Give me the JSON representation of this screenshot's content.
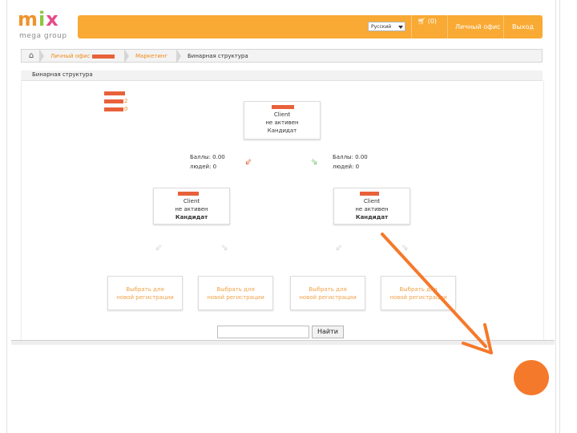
{
  "logo": {
    "mark": "mix",
    "sub": "mega group"
  },
  "topbar": {
    "language": "Русский",
    "cart_count": "(0)",
    "nav_office": "Личный офис",
    "nav_logout": "Выход",
    "accent": "#f8aa34"
  },
  "breadcrumb": {
    "home_icon": "home-icon",
    "item1": "Личный офис",
    "item2": "Маркетинг",
    "item3": "Бинарная структура"
  },
  "section": {
    "title": "Бинарная структура"
  },
  "id_stack": {
    "digit1": "2",
    "digit2": "0"
  },
  "root": {
    "client": "Client",
    "status": "не активен",
    "rank": "Кандидат"
  },
  "left_stats": {
    "points": "Баллы: 0.00",
    "people": "людей: 0"
  },
  "right_stats": {
    "points": "Баллы: 0.00",
    "people": "людей: 0"
  },
  "child_left": {
    "client": "Client",
    "status": "не активен",
    "rank": "Кандидат"
  },
  "child_right": {
    "client": "Client",
    "status": "не активен",
    "rank": "Кандидат"
  },
  "empty_slots": [
    {
      "line1": "Выбрать для",
      "line2": "новой регистрации"
    },
    {
      "line1": "Выбрать для",
      "line2": "новой регистрации"
    },
    {
      "line1": "Выбрать для",
      "line2": "новой регистрации"
    },
    {
      "line1": "Выбрать для",
      "line2": "новой регистрации"
    }
  ],
  "search": {
    "button": "Найти",
    "value": ""
  },
  "annotation": {
    "color": "#f5792b"
  }
}
